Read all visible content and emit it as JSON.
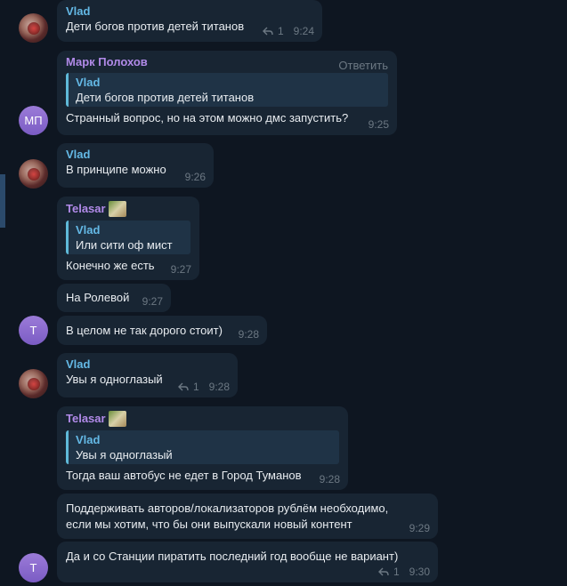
{
  "messages": [
    {
      "sender": "Vlad",
      "text": "Дети богов против детей титанов",
      "reply_count": "1",
      "time": "9:24"
    },
    {
      "sender": "Марк Полохов",
      "avatar_initials": "МП",
      "reply_action": "Ответить",
      "quote_name": "Vlad",
      "quote_text": "Дети богов против детей титанов",
      "text": "Странный вопрос, но на этом можно дмс запустить?",
      "time": "9:25"
    },
    {
      "sender": "Vlad",
      "text": "В принципе можно",
      "time": "9:26"
    },
    {
      "sender": "Telasar",
      "quote_name": "Vlad",
      "quote_text": "Или сити оф мист",
      "text": "Конечно же есть",
      "time": "9:27"
    },
    {
      "text": "На Ролевой",
      "time": "9:27"
    },
    {
      "avatar_initials": "Т",
      "text": "В целом не так дорого стоит)",
      "time": "9:28"
    },
    {
      "sender": "Vlad",
      "text": "Увы я одноглазый",
      "reply_count": "1",
      "time": "9:28"
    },
    {
      "sender": "Telasar",
      "quote_name": "Vlad",
      "quote_text": "Увы я одноглазый",
      "text": "Тогда ваш автобус не едет в Город Туманов",
      "time": "9:28"
    },
    {
      "text_line1": "Поддерживать авторов/локализаторов рублём необходимо,",
      "text_line2": "если мы хотим, что бы они выпускали новый контент",
      "time": "9:29"
    },
    {
      "avatar_initials": "Т",
      "text": "Да и со Станции пиратить последний год вообще не вариант)",
      "reply_count": "1",
      "time": "9:30"
    }
  ]
}
